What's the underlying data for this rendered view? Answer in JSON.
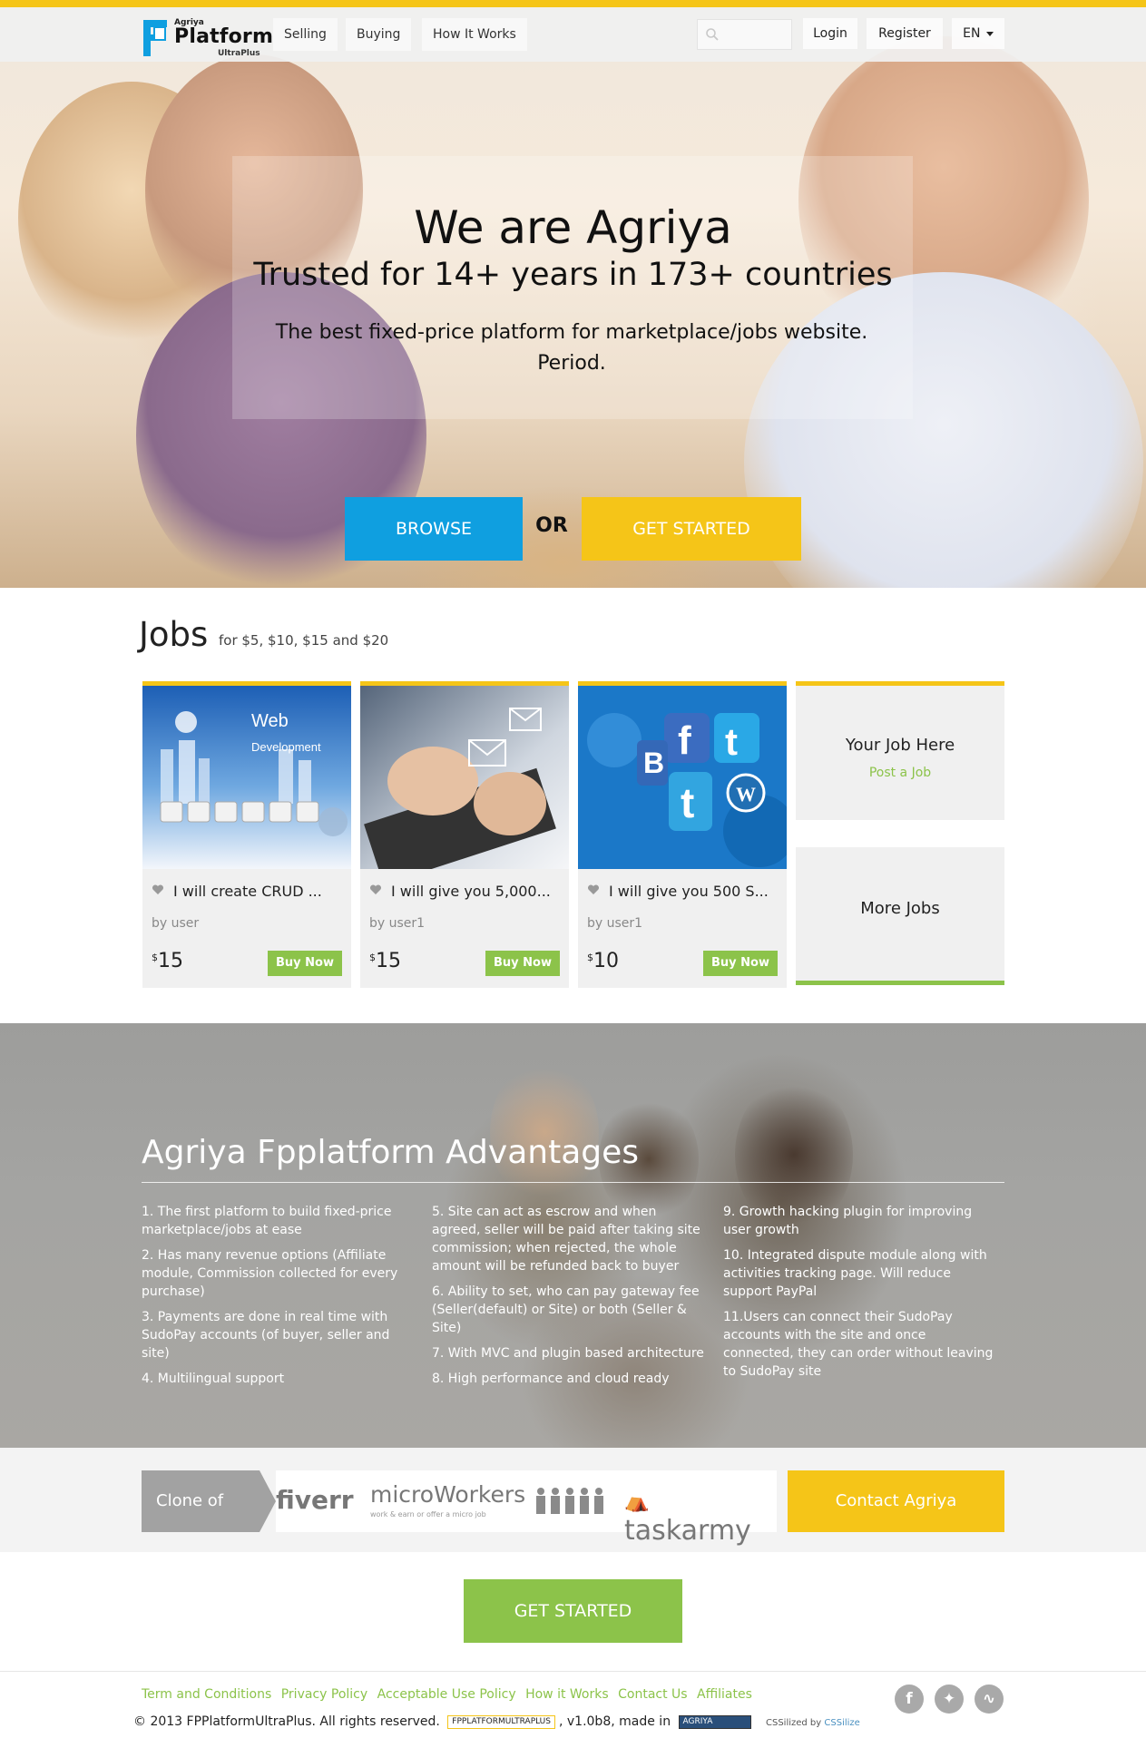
{
  "brand": {
    "top": "Agriya",
    "name": "Platform",
    "sub": "UltraPlus"
  },
  "nav": {
    "items": [
      {
        "label": "Selling"
      },
      {
        "label": "Buying"
      },
      {
        "label": "How It Works"
      }
    ],
    "search_placeholder": "",
    "login": "Login",
    "register": "Register",
    "language": "EN"
  },
  "hero": {
    "title": "We are Agriya",
    "subtitle": "Trusted for 14+ years in 173+ countries",
    "text": "The best fixed-price platform for marketplace/jobs website. Period.",
    "browse": "BROWSE",
    "or": "OR",
    "get_started": "GET STARTED"
  },
  "jobs": {
    "title": "Jobs",
    "subtitle": "for $5, $10, $15 and $20",
    "cards": [
      {
        "title": "I will create CRUD ...",
        "by": "by user",
        "currency": "$",
        "price": "15",
        "buy": "Buy Now"
      },
      {
        "title": "I will give you 5,000...",
        "by": "by user1",
        "currency": "$",
        "price": "15",
        "buy": "Buy Now"
      },
      {
        "title": "I will give you 500 S...",
        "by": "by user1",
        "currency": "$",
        "price": "10",
        "buy": "Buy Now"
      }
    ],
    "your_job": "Your Job Here",
    "post_job": "Post a Job",
    "more_jobs": "More Jobs"
  },
  "advantages": {
    "title": "Agriya Fpplatform Advantages",
    "columns": [
      [
        "1. The first platform to build fixed-price marketplace/jobs at ease",
        "2. Has many revenue options (Affiliate module, Commission collected for every purchase)",
        "3. Payments are done in real time with SudoPay accounts (of buyer, seller and site)",
        "4. Multilingual support"
      ],
      [
        "5. Site can act as escrow and when agreed, seller will be paid after taking site commission; when rejected, the whole amount will be refunded back to buyer",
        "6. Ability to set, who can pay gateway fee (Seller(default) or Site) or both (Seller & Site)",
        "7. With MVC and plugin based architecture",
        "8. High performance and cloud ready"
      ],
      [
        "9. Growth hacking plugin for improving user growth",
        "10. Integrated dispute module along with activities tracking page. Will reduce support PayPal",
        "11.Users can connect their SudoPay accounts with the site and once connected, they can order without leaving to SudoPay site"
      ]
    ]
  },
  "clone": {
    "label": "Clone of",
    "fiverr": "fiverr",
    "microworkers": "microWorkers",
    "microworkers_sub": "work & earn or offer a micro job",
    "taskarmy": "taskarmy",
    "contact": "Contact Agriya"
  },
  "cta": {
    "get_started": "GET STARTED"
  },
  "footer": {
    "links": [
      "Term and Conditions",
      "Privacy Policy",
      "Acceptable Use Policy",
      "How it Works",
      "Contact Us",
      "Affiliates"
    ],
    "copyright": "© 2013 FPPlatformUltraPlus. All rights reserved.",
    "fp_badge": "FPPLATFORMULTRAPLUS",
    "version": ", v1.0b8,",
    "made_in": "made in",
    "agriya_badge": "AGRIYA",
    "cssilized": "CSSilized by",
    "cssilize": "CSSilize",
    "social": [
      "facebook-icon",
      "twitter-icon",
      "rss-icon"
    ]
  },
  "colors": {
    "accent_yellow": "#f5c518",
    "accent_blue": "#0f9fe0",
    "accent_green": "#8cc34a"
  }
}
